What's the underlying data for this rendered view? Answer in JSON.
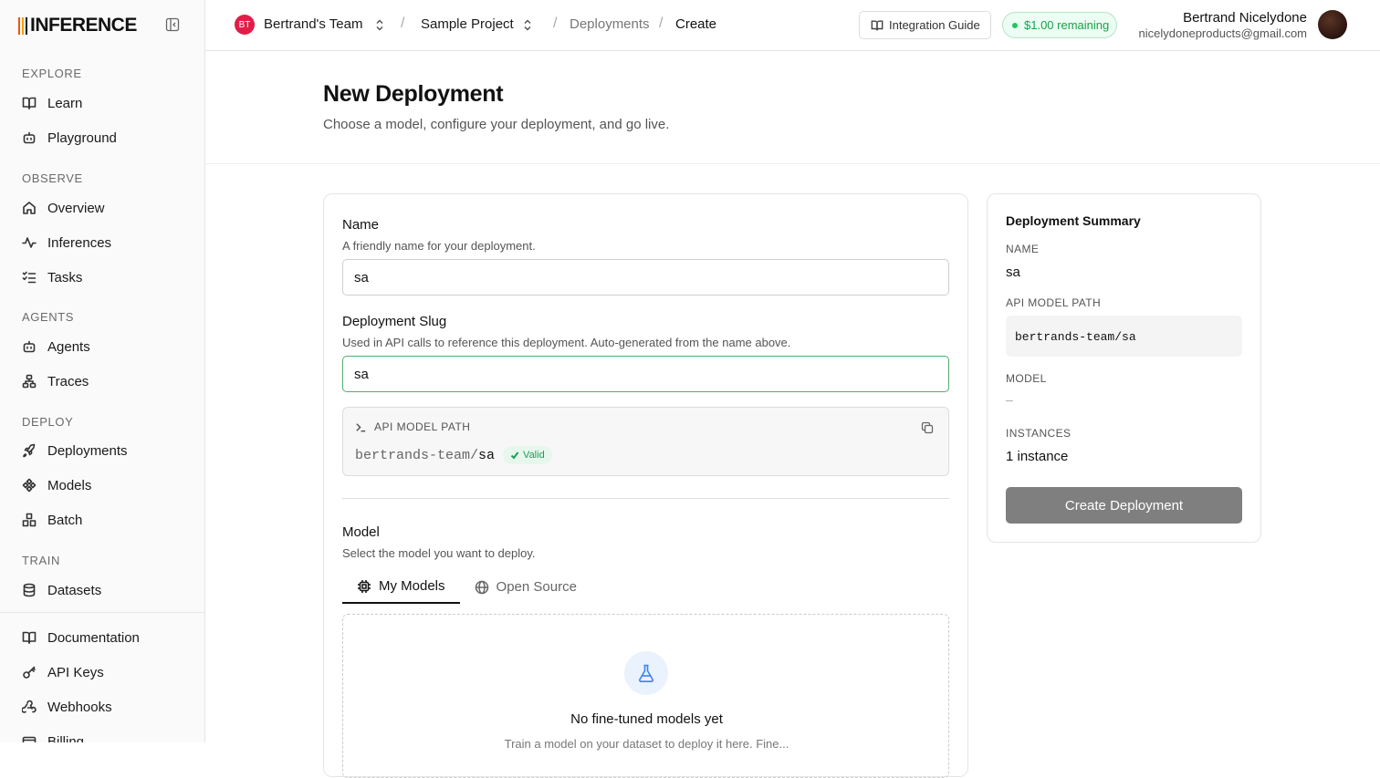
{
  "brand": {
    "name": "INFERENCE"
  },
  "sidebar": {
    "sections": [
      {
        "title": "EXPLORE",
        "items": [
          {
            "label": "Learn",
            "icon": "book-icon"
          },
          {
            "label": "Playground",
            "icon": "bot-icon"
          }
        ]
      },
      {
        "title": "OBSERVE",
        "items": [
          {
            "label": "Overview",
            "icon": "home-icon"
          },
          {
            "label": "Inferences",
            "icon": "activity-icon"
          },
          {
            "label": "Tasks",
            "icon": "list-checks-icon"
          }
        ]
      },
      {
        "title": "AGENTS",
        "items": [
          {
            "label": "Agents",
            "icon": "bot-icon"
          },
          {
            "label": "Traces",
            "icon": "network-icon"
          }
        ]
      },
      {
        "title": "DEPLOY",
        "items": [
          {
            "label": "Deployments",
            "icon": "rocket-icon"
          },
          {
            "label": "Models",
            "icon": "models-icon"
          },
          {
            "label": "Batch",
            "icon": "boxes-icon"
          }
        ]
      },
      {
        "title": "TRAIN",
        "items": [
          {
            "label": "Datasets",
            "icon": "database-icon"
          }
        ]
      }
    ],
    "footer_items": [
      {
        "label": "Documentation",
        "icon": "book-icon"
      },
      {
        "label": "API Keys",
        "icon": "key-icon"
      },
      {
        "label": "Webhooks",
        "icon": "webhook-icon"
      },
      {
        "label": "Billing",
        "icon": "credit-card-icon"
      }
    ]
  },
  "header": {
    "team_initials": "BT",
    "team_name": "Bertrand's Team",
    "project_name": "Sample Project",
    "crumb_deployments": "Deployments",
    "crumb_current": "Create",
    "integration_guide": "Integration Guide",
    "credit": "$1.00 remaining",
    "user_name": "Bertrand Nicelydone",
    "user_email": "nicelydoneproducts@gmail.com"
  },
  "page": {
    "title": "New Deployment",
    "subtitle": "Choose a model, configure your deployment, and go live."
  },
  "form": {
    "name_label": "Name",
    "name_help": "A friendly name for your deployment.",
    "name_value": "sa",
    "slug_label": "Deployment Slug",
    "slug_help": "Used in API calls to reference this deployment. Auto-generated from the name above.",
    "slug_value": "sa",
    "path_label": "API MODEL PATH",
    "path_team": "bertrands-team/",
    "path_slug": "sa",
    "valid_label": "Valid",
    "model_label": "Model",
    "model_help": "Select the model you want to deploy.",
    "tabs": [
      {
        "label": "My Models",
        "icon": "chip-icon",
        "active": true
      },
      {
        "label": "Open Source",
        "icon": "globe-icon",
        "active": false
      }
    ],
    "empty_title": "No fine-tuned models yet",
    "empty_sub": "Train a model on your dataset to deploy it here. Fine..."
  },
  "summary": {
    "title": "Deployment Summary",
    "name_label": "NAME",
    "name_value": "sa",
    "path_label": "API MODEL PATH",
    "path_value": "bertrands-team/sa",
    "model_label": "MODEL",
    "model_value": "–",
    "instances_label": "INSTANCES",
    "instances_value": "1 instance",
    "create_button": "Create Deployment"
  }
}
